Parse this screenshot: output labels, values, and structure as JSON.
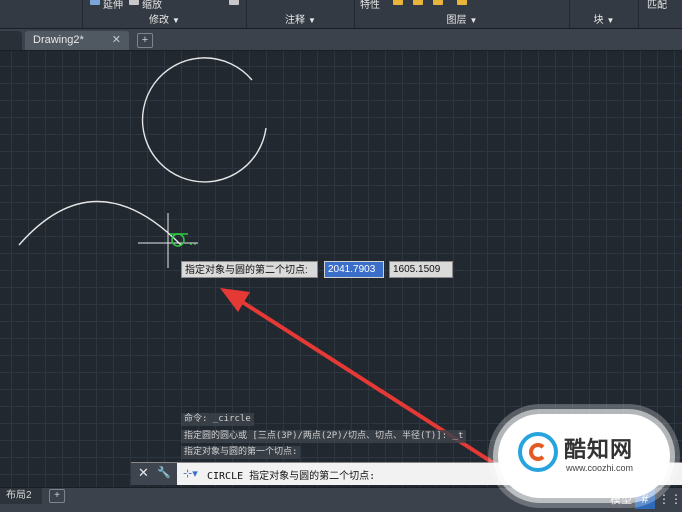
{
  "ribbon": {
    "panels": [
      {
        "title": "修改",
        "top_labels": [
          "延伸",
          "缩放"
        ]
      },
      {
        "title": "注释",
        "top_labels": []
      },
      {
        "title": "图层",
        "top_labels": [
          "特性"
        ]
      },
      {
        "title": "块",
        "top_labels": []
      },
      {
        "title": "",
        "top_labels": [
          "匹配"
        ]
      }
    ]
  },
  "tabs": {
    "active": "Drawing2*",
    "close_glyph": "✕",
    "add_glyph": "+"
  },
  "dynamic_input": {
    "prompt": "指定对象与圆的第二个切点:",
    "x_value": "2041.7903",
    "y_value": "1605.1509"
  },
  "command_history": [
    "命令: _circle",
    "指定圆的圆心或 [三点(3P)/两点(2P)/切点、切点、半径(T)]: _t",
    "指定对象与圆的第一个切点:"
  ],
  "command_line": {
    "text": "CIRCLE 指定对象与圆的第二个切点:",
    "close_glyph": "✕",
    "wrench_glyph": "🔧",
    "prompt_glyph": "⊹▾"
  },
  "statusbar": {
    "layout_tab": "布局2",
    "add_glyph": "+",
    "model_label": "模型",
    "grid_glyph": "#",
    "snap_glyph": "⋮⋮"
  },
  "watermark": {
    "brand": "酷知网",
    "url": "www.coozhi.com"
  },
  "colors": {
    "canvas_bg": "#212830",
    "grid": "#2e3641",
    "geometry": "#e6e6e6",
    "annotation_arrow": "#e53935",
    "highlight": "#3a6ec8"
  }
}
